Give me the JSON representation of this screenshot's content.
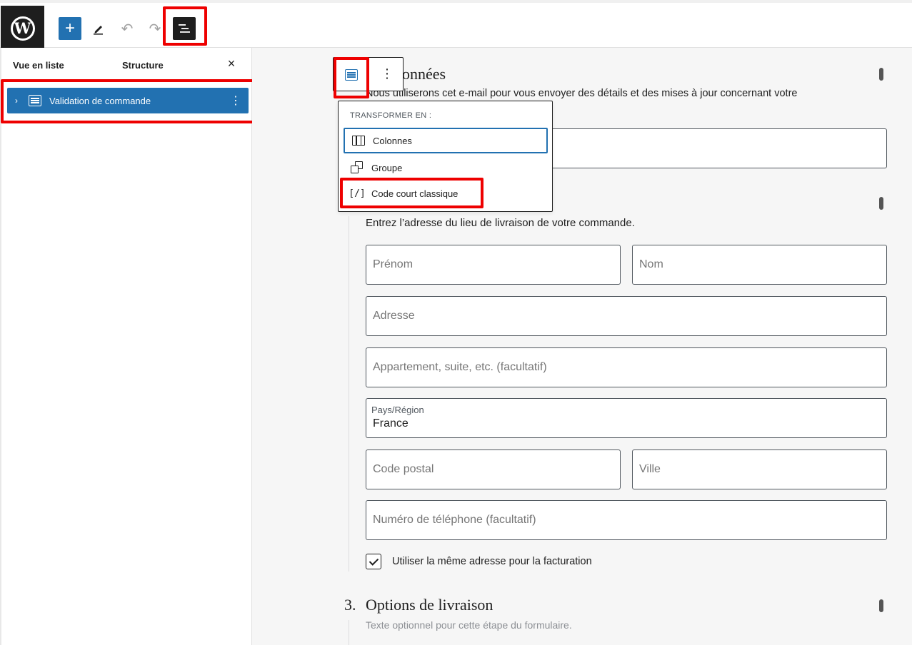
{
  "toolbar": {
    "logo_letter": "W",
    "add_label": "+",
    "undo_label": "↶",
    "redo_label": "↷"
  },
  "sidebar": {
    "tab_list": "Vue en liste",
    "tab_structure": "Structure",
    "close_label": "×",
    "items": [
      {
        "label": "Validation de commande",
        "chevron": "›",
        "menu": "⋮"
      }
    ]
  },
  "block_toolbar": {
    "menu": "⋮"
  },
  "transform_menu": {
    "title": "TRANSFORMER EN :",
    "items": [
      {
        "label": "Colonnes",
        "icon": "columns-icon"
      },
      {
        "label": "Groupe",
        "icon": "group-icon"
      },
      {
        "label": "Code court classique",
        "icon": "shortcode-icon",
        "glyph": "[/]"
      }
    ]
  },
  "sections": {
    "contact": {
      "title_fragment": "données",
      "description": "Nous utiliserons cet e-mail pour vous envoyer des détails et des mises à jour concernant votre"
    },
    "shipping": {
      "description": "Entrez l’adresse du lieu de livraison de votre commande.",
      "fields": {
        "first_name": "Prénom",
        "last_name": "Nom",
        "address": "Adresse",
        "address2": "Appartement, suite, etc. (facultatif)",
        "country_label": "Pays/Région",
        "country_value": "France",
        "postcode": "Code postal",
        "city": "Ville",
        "phone": "Numéro de téléphone (facultatif)"
      },
      "same_billing_label": "Utiliser la même adresse pour la facturation",
      "same_billing_checked": true
    },
    "delivery": {
      "number": "3.",
      "title": "Options de livraison",
      "description": "Texte optionnel pour cette étape du formulaire."
    }
  },
  "colors": {
    "accent": "#2271b1",
    "highlight": "#ee0000",
    "dark": "#1e1e1e"
  }
}
